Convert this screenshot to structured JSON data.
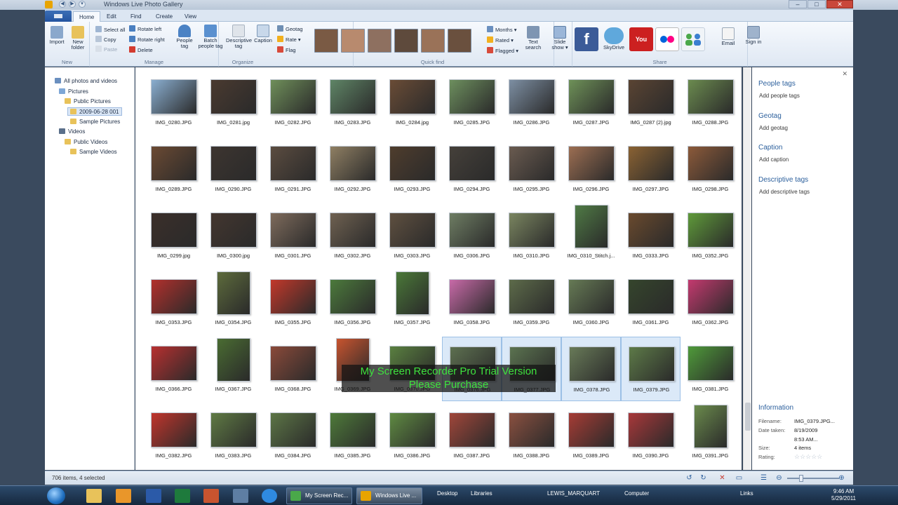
{
  "window": {
    "title": "Windows Live Photo Gallery"
  },
  "tabs": [
    {
      "label": "Home",
      "active": true
    },
    {
      "label": "Edit",
      "active": false
    },
    {
      "label": "Find",
      "active": false
    },
    {
      "label": "Create",
      "active": false
    },
    {
      "label": "View",
      "active": false
    }
  ],
  "ribbon": {
    "new": {
      "label": "New",
      "import": "Import",
      "new_folder": "New folder"
    },
    "manage": {
      "label": "Manage",
      "select_all": "Select all",
      "copy": "Copy",
      "paste": "Paste",
      "rotate_left": "Rotate left",
      "rotate_right": "Rotate right",
      "delete": "Delete"
    },
    "organize": {
      "label": "Organize",
      "people_tag": "People tag",
      "batch_people_tag": "Batch people tag",
      "descriptive_tag": "Descriptive tag",
      "caption": "Caption",
      "geotag": "Geotag",
      "rate": "Rate",
      "flag": "Flag"
    },
    "quick_find": {
      "label": "Quick find",
      "months": "Months",
      "rated": "Rated",
      "flagged": "Flagged",
      "text_search": "Text search"
    },
    "slide_show": "Slide show",
    "share": {
      "label": "Share",
      "skydrive": "SkyDrive",
      "email": "Email"
    },
    "sign_in": "Sign in"
  },
  "nav": [
    {
      "label": "All photos and videos",
      "icon": "photos-icon"
    },
    {
      "label": "Pictures",
      "icon": "pictures-icon"
    },
    {
      "label": "Public Pictures",
      "icon": "folder-icon"
    },
    {
      "label": "2009-06-28 001",
      "icon": "folder-icon",
      "selected": true
    },
    {
      "label": "Sample Pictures",
      "icon": "folder-icon"
    },
    {
      "label": "Videos",
      "icon": "videos-icon"
    },
    {
      "label": "Public Videos",
      "icon": "folder-icon"
    },
    {
      "label": "Sample Videos",
      "icon": "folder-icon"
    }
  ],
  "photos": [
    {
      "name": "IMG_0280.JPG",
      "color": "#8aaed0"
    },
    {
      "name": "IMG_0281.jpg",
      "color": "#4a3a30"
    },
    {
      "name": "IMG_0282.JPG",
      "color": "#6f8f5a"
    },
    {
      "name": "IMG_0283.JPG",
      "color": "#5f8566"
    },
    {
      "name": "IMG_0284.jpg",
      "color": "#6a4c36"
    },
    {
      "name": "IMG_0285.JPG",
      "color": "#6d8f5e"
    },
    {
      "name": "IMG_0286.JPG",
      "color": "#7d8fa3"
    },
    {
      "name": "IMG_0287.JPG",
      "color": "#6e9158"
    },
    {
      "name": "IMG_0287 (2).jpg",
      "color": "#5a4433"
    },
    {
      "name": "IMG_0288.JPG",
      "color": "#6b8b4f"
    },
    {
      "name": "IMG_0289.JPG",
      "color": "#6b4a33"
    },
    {
      "name": "IMG_0290.JPG",
      "color": "#3d3530"
    },
    {
      "name": "IMG_0291.JPG",
      "color": "#5b4c40"
    },
    {
      "name": "IMG_0292.JPG",
      "color": "#8f7f63"
    },
    {
      "name": "IMG_0293.JPG",
      "color": "#4f3d2d"
    },
    {
      "name": "IMG_0294.JPG",
      "color": "#45403a"
    },
    {
      "name": "IMG_0295.JPG",
      "color": "#6a5b50"
    },
    {
      "name": "IMG_0296.JPG",
      "color": "#9c6e52"
    },
    {
      "name": "IMG_0297.JPG",
      "color": "#8a6233"
    },
    {
      "name": "IMG_0298.JPG",
      "color": "#8c5a3a"
    },
    {
      "name": "IMG_0299.jpg",
      "color": "#3b2f2a"
    },
    {
      "name": "IMG_0300.jpg",
      "color": "#43362f"
    },
    {
      "name": "IMG_0301.JPG",
      "color": "#7e6b5c"
    },
    {
      "name": "IMG_0302.JPG",
      "color": "#6f6151"
    },
    {
      "name": "IMG_0303.JPG",
      "color": "#5f5040"
    },
    {
      "name": "IMG_0306.JPG",
      "color": "#6e7d63"
    },
    {
      "name": "IMG_0310.JPG",
      "color": "#7a8560"
    },
    {
      "name": "IMG_0310_Stitch.j...",
      "color": "#4f7a45",
      "portrait": true
    },
    {
      "name": "IMG_0333.JPG",
      "color": "#6a4a2e"
    },
    {
      "name": "IMG_0352.JPG",
      "color": "#5f9a3a"
    },
    {
      "name": "IMG_0353.JPG",
      "color": "#b2302c"
    },
    {
      "name": "IMG_0354.JPG",
      "color": "#5d6b3c",
      "portrait": true
    },
    {
      "name": "IMG_0355.JPG",
      "color": "#c2382a"
    },
    {
      "name": "IMG_0356.JPG",
      "color": "#4c7a3c"
    },
    {
      "name": "IMG_0357.JPG",
      "color": "#4a7838",
      "portrait": true
    },
    {
      "name": "IMG_0358.JPG",
      "color": "#c86aa8"
    },
    {
      "name": "IMG_0359.JPG",
      "color": "#5d6b4a"
    },
    {
      "name": "IMG_0360.JPG",
      "color": "#667a55"
    },
    {
      "name": "IMG_0361.JPG",
      "color": "#35452c"
    },
    {
      "name": "IMG_0362.JPG",
      "color": "#c43a6f"
    },
    {
      "name": "IMG_0366.JPG",
      "color": "#b73030"
    },
    {
      "name": "IMG_0367.JPG",
      "color": "#4a6c32",
      "portrait": true
    },
    {
      "name": "IMG_0368.JPG",
      "color": "#8a4a3a"
    },
    {
      "name": "IMG_0369.JPG",
      "color": "#c8542f",
      "portrait": true
    },
    {
      "name": "IMG_0370.JPG",
      "color": "#5a8040"
    },
    {
      "name": "IMG_0376.JPG",
      "color": "#5d7050",
      "selected": true
    },
    {
      "name": "IMG_0377.JPG",
      "color": "#5b7350",
      "selected": true
    },
    {
      "name": "IMG_0378.JPG",
      "color": "#687a58",
      "selected": true
    },
    {
      "name": "IMG_0379.JPG",
      "color": "#5d7a48",
      "selected": true
    },
    {
      "name": "IMG_0381.JPG",
      "color": "#4f9a3a"
    },
    {
      "name": "IMG_0382.JPG",
      "color": "#c0352c"
    },
    {
      "name": "IMG_0383.JPG",
      "color": "#5f7a44"
    },
    {
      "name": "IMG_0384.JPG",
      "color": "#5c7546"
    },
    {
      "name": "IMG_0385.JPG",
      "color": "#4e7a3a"
    },
    {
      "name": "IMG_0386.JPG",
      "color": "#5f8a42"
    },
    {
      "name": "IMG_0387.JPG",
      "color": "#a0463a"
    },
    {
      "name": "IMG_0388.JPG",
      "color": "#8a5040"
    },
    {
      "name": "IMG_0389.JPG",
      "color": "#a63c35"
    },
    {
      "name": "IMG_0390.JPG",
      "color": "#a8383a"
    },
    {
      "name": "IMG_0391.JPG",
      "color": "#6a8a4c",
      "portrait": true
    }
  ],
  "info_pane": {
    "people_tags": {
      "heading": "People tags",
      "link": "Add people tags"
    },
    "geotag": {
      "heading": "Geotag",
      "link": "Add geotag"
    },
    "caption": {
      "heading": "Caption",
      "link": "Add caption"
    },
    "descriptive_tags": {
      "heading": "Descriptive tags",
      "link": "Add descriptive tags"
    },
    "information": {
      "heading": "Information",
      "filename_label": "Filename:",
      "filename": "IMG_0379.JPG...",
      "date_label": "Date taken:",
      "date": "8/19/2009",
      "time": "8:53 AM...",
      "size_label": "Size:",
      "size": "4 items",
      "rating_label": "Rating:",
      "rating": "☆☆☆☆☆"
    }
  },
  "status": {
    "text": "706 items, 4 selected"
  },
  "watermark": {
    "line1": "My Screen Recorder Pro Trial Version",
    "line2": "Please Purchase"
  },
  "taskbar": {
    "tasks": [
      {
        "label": "My Screen Rec...",
        "active": false
      },
      {
        "label": "Windows Live ...",
        "active": true
      }
    ],
    "desktop": "Desktop",
    "libraries": "Libraries",
    "lewis": "LEWIS_MARQUART",
    "computer": "Computer",
    "links": "Links",
    "clock_time": "9:46 AM",
    "clock_date": "5/29/2011"
  }
}
